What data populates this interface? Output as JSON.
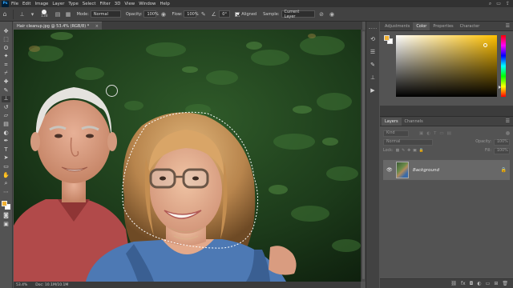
{
  "menubar": {
    "logo": "Ps",
    "items": [
      "File",
      "Edit",
      "Image",
      "Layer",
      "Type",
      "Select",
      "Filter",
      "3D",
      "View",
      "Window",
      "Help"
    ],
    "right_icons": [
      "search-icon",
      "workspace-icon",
      "share-icon"
    ]
  },
  "options": {
    "brush_size": "138",
    "mode_label": "Mode:",
    "mode_value": "Normal",
    "opacity_label": "Opacity:",
    "opacity_value": "100%",
    "flow_label": "Flow:",
    "flow_value": "100%",
    "angle_value": "0°",
    "aligned_label": "Aligned",
    "aligned_checked": true,
    "sample_label": "Sample:",
    "sample_value": "Current Layer"
  },
  "document": {
    "tab_title": "Hair cleanup.jpg @ 53.4% (RGB/8) *",
    "close_glyph": "×"
  },
  "status": {
    "zoom": "53.4%",
    "doc_size": "Doc: 10.1M/10.1M"
  },
  "panels": {
    "top_tabs": [
      "Adjustments",
      "Color",
      "Properties",
      "Character"
    ],
    "top_active": "Color",
    "color": {
      "foreground": "#f2b233",
      "background": "#ffffff",
      "picker_hue": "#ffc000"
    },
    "layers_tabs": [
      "Layers",
      "Channels"
    ],
    "layers_active": "Layers",
    "filter_placeholder": "Kind",
    "blend_mode": "Normal",
    "opacity_label": "Opacity:",
    "opacity_value": "100%",
    "lock_label": "Lock:",
    "fill_label": "Fill:",
    "fill_value": "100%",
    "layers": [
      {
        "name": "Background",
        "visible": true,
        "locked": true
      }
    ]
  },
  "colors": {
    "accent_selection": "#ffffff"
  }
}
